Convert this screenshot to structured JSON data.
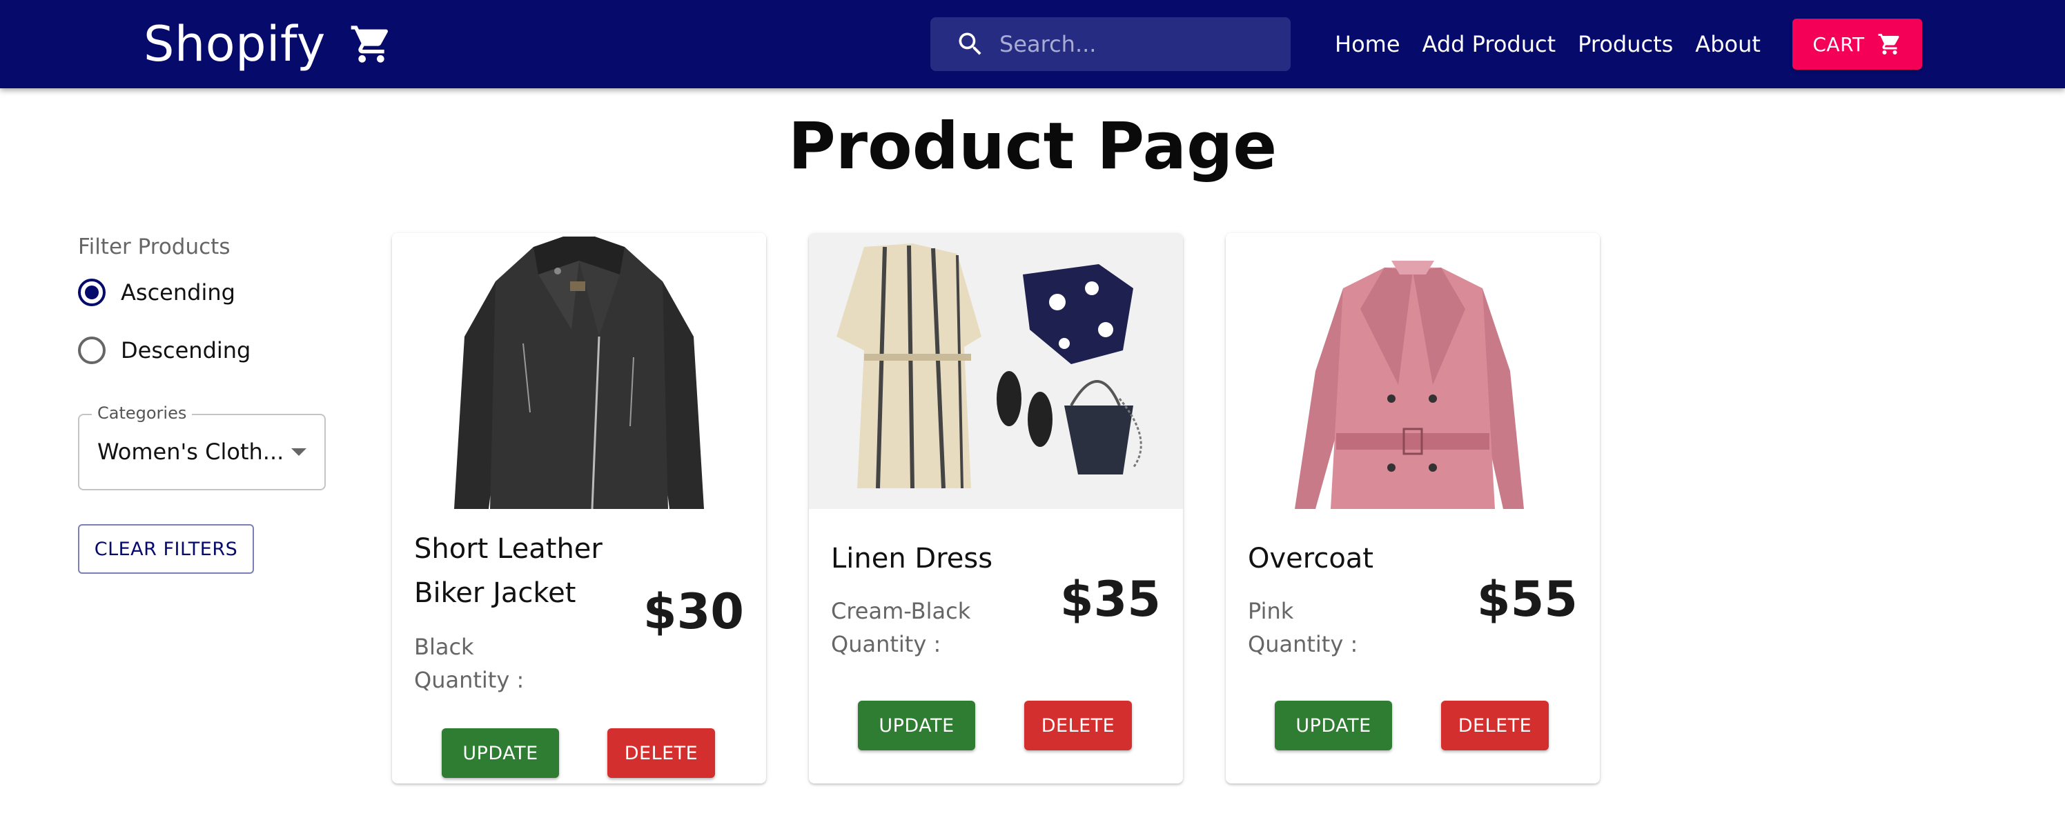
{
  "header": {
    "brand": "Shopify",
    "search_placeholder": "Search...",
    "nav": [
      "Home",
      "Add Product",
      "Products",
      "About"
    ],
    "cart_label": "CART",
    "colors": {
      "appbar": "#050a6b",
      "cart": "#f50057"
    }
  },
  "page": {
    "title": "Product Page"
  },
  "sidebar": {
    "filter_heading": "Filter Products",
    "sort_options": [
      {
        "label": "Ascending",
        "selected": true
      },
      {
        "label": "Descending",
        "selected": false
      }
    ],
    "categories_label": "Categories",
    "categories_value": "Women's Cloth...",
    "clear_filters": "CLEAR FILTERS"
  },
  "products": [
    {
      "name": "Short Leather Biker Jacket",
      "color": "Black",
      "quantity_label": "Quantity :",
      "price": "$30",
      "update": "UPDATE",
      "delete": "DELETE",
      "image_icon": "leather-jacket-image"
    },
    {
      "name": "Linen Dress",
      "color": "Cream-Black",
      "quantity_label": "Quantity :",
      "price": "$35",
      "update": "UPDATE",
      "delete": "DELETE",
      "image_icon": "linen-dress-image"
    },
    {
      "name": "Overcoat",
      "color": "Pink",
      "quantity_label": "Quantity :",
      "price": "$55",
      "update": "UPDATE",
      "delete": "DELETE",
      "image_icon": "overcoat-image"
    }
  ]
}
